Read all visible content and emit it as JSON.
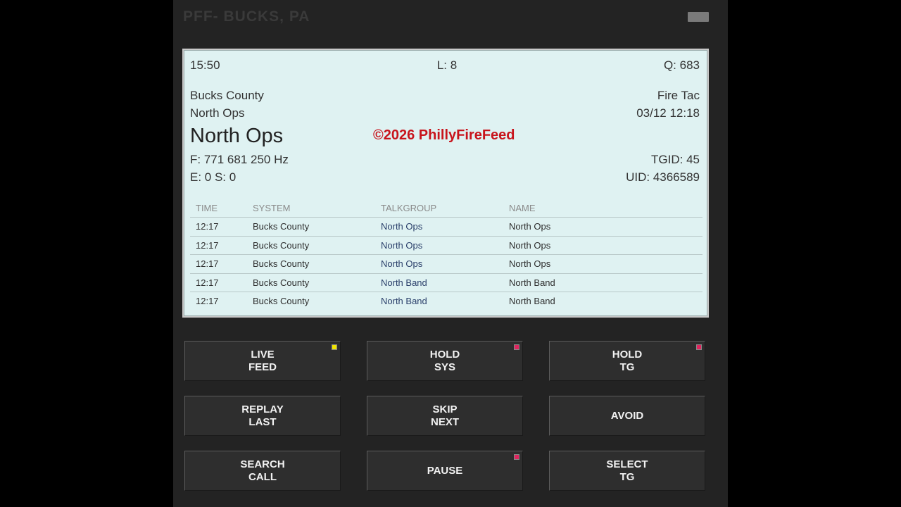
{
  "app": {
    "title": "PFF- BUCKS, PA"
  },
  "display": {
    "time": "15:50",
    "level": "L: 8",
    "queue": "Q: 683",
    "system": "Bucks County",
    "site": "North Ops",
    "tag": "Fire Tac",
    "datetime": "03/12 12:18",
    "talkgroup_name": "North Ops",
    "watermark": "©2026 PhillyFireFeed",
    "frequency": "F: 771 681 250 Hz",
    "errors": "E: 0 S: 0",
    "tgid": "TGID: 45",
    "uid": "UID: 4366589"
  },
  "log": {
    "headers": [
      "TIME",
      "SYSTEM",
      "TALKGROUP",
      "NAME"
    ],
    "rows": [
      {
        "time": "12:17",
        "system": "Bucks County",
        "talkgroup": "North Ops",
        "name": "North Ops"
      },
      {
        "time": "12:17",
        "system": "Bucks County",
        "talkgroup": "North Ops",
        "name": "North Ops"
      },
      {
        "time": "12:17",
        "system": "Bucks County",
        "talkgroup": "North Ops",
        "name": "North Ops"
      },
      {
        "time": "12:17",
        "system": "Bucks County",
        "talkgroup": "North Band",
        "name": "North Band"
      },
      {
        "time": "12:17",
        "system": "Bucks County",
        "talkgroup": "North Band",
        "name": "North Band"
      }
    ]
  },
  "buttons": {
    "live_feed": {
      "line1": "LIVE",
      "line2": "FEED",
      "indicator": "#f2e600"
    },
    "hold_sys": {
      "line1": "HOLD",
      "line2": "SYS",
      "indicator": "#e0245e"
    },
    "hold_tg": {
      "line1": "HOLD",
      "line2": "TG",
      "indicator": "#e0245e"
    },
    "replay_last": {
      "line1": "REPLAY",
      "line2": "LAST"
    },
    "skip_next": {
      "line1": "SKIP",
      "line2": "NEXT"
    },
    "avoid": {
      "line1": "AVOID"
    },
    "search_call": {
      "line1": "SEARCH",
      "line2": "CALL"
    },
    "pause": {
      "line1": "PAUSE",
      "indicator": "#e0245e"
    },
    "select_tg": {
      "line1": "SELECT",
      "line2": "TG"
    }
  }
}
